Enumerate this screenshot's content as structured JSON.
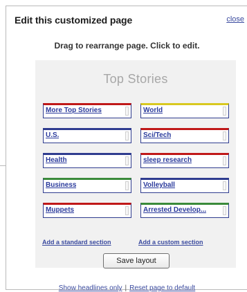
{
  "dialog": {
    "title": "Edit this customized page",
    "close_label": "close",
    "instructions": "Drag to rearrange page.  Click to edit."
  },
  "layout_panel": {
    "section_title": "Top Stories",
    "columns": [
      {
        "boxes": [
          {
            "label": "More Top Stories",
            "accent_color": "#c01818"
          },
          {
            "label": "U.S.",
            "accent_color": "#2f3c8f"
          },
          {
            "label": "Health",
            "accent_color": "#2f3c8f"
          },
          {
            "label": "Business",
            "accent_color": "#3a8a3a"
          },
          {
            "label": "Muppets",
            "accent_color": "#c01818"
          }
        ]
      },
      {
        "boxes": [
          {
            "label": "World",
            "accent_color": "#d8c820"
          },
          {
            "label": "Sci/Tech",
            "accent_color": "#c01818"
          },
          {
            "label": "sleep research",
            "accent_color": "#c01818"
          },
          {
            "label": "Volleyball",
            "accent_color": "#2f3c8f"
          },
          {
            "label": "Arrested Develop...",
            "accent_color": "#3a8a3a"
          }
        ]
      }
    ],
    "add_standard_label": "Add a standard section",
    "add_custom_label": "Add a custom section",
    "save_label": "Save layout"
  },
  "footer": {
    "show_headlines_label": "Show headlines only",
    "separator": "|",
    "reset_label": "Reset page to default"
  },
  "colors": {
    "link": "#3b4b9f",
    "box_border": "#2f3c8f",
    "panel_background": "#f1f1f1"
  }
}
